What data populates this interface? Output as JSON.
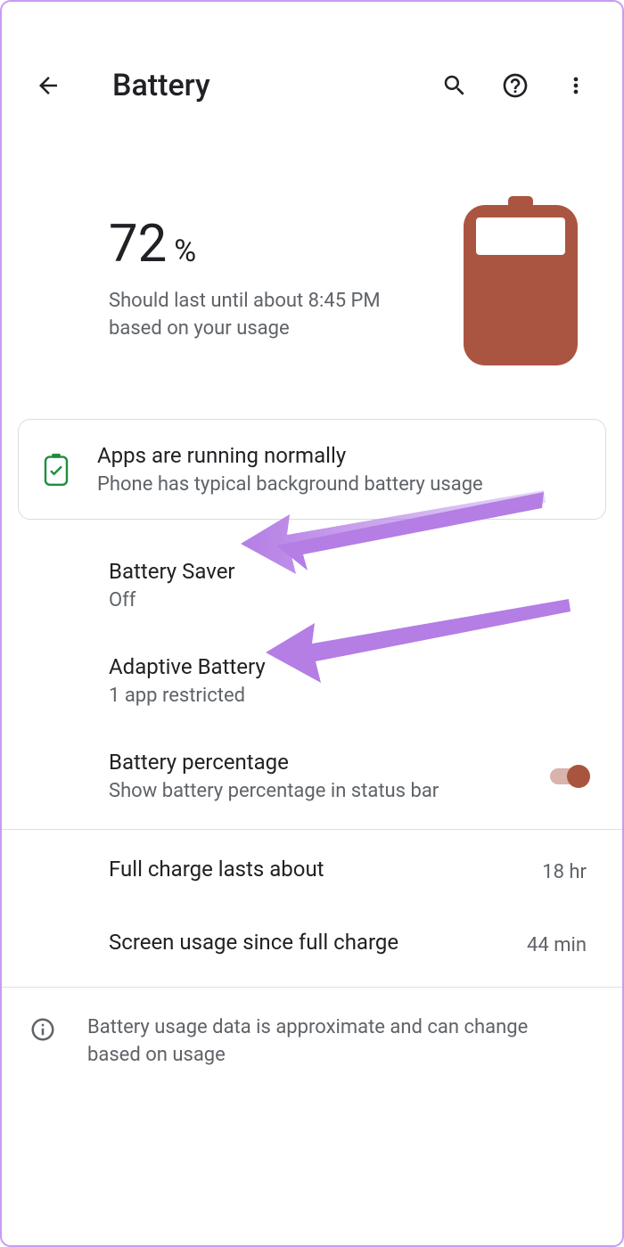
{
  "header": {
    "title": "Battery"
  },
  "battery": {
    "percent_num": "72",
    "percent_sym": "%",
    "estimate": "Should last until about 8:45 PM based on your usage",
    "fill_color": "#aa5542"
  },
  "status": {
    "title": "Apps are running normally",
    "sub": "Phone has typical background battery usage"
  },
  "items": {
    "saver": {
      "title": "Battery Saver",
      "sub": "Off"
    },
    "adaptive": {
      "title": "Adaptive Battery",
      "sub": "1 app restricted"
    },
    "percentage": {
      "title": "Battery percentage",
      "sub": "Show battery percentage in status bar",
      "on": true
    }
  },
  "stats": {
    "full_charge": {
      "title": "Full charge lasts about",
      "value": "18 hr"
    },
    "screen_usage": {
      "title": "Screen usage since full charge",
      "value": "44 min"
    }
  },
  "footer": {
    "text": "Battery usage data is approximate and can change based on usage"
  },
  "annotation": {
    "arrow_color": "#b47ee5"
  }
}
